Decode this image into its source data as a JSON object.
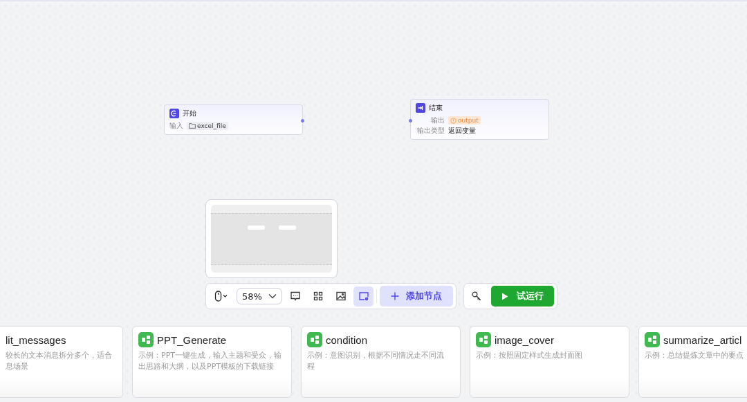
{
  "nodes": [
    {
      "kind": "start",
      "title": "开始",
      "fields": [
        {
          "label": "输入",
          "value": "excel_file"
        }
      ]
    },
    {
      "kind": "end",
      "title": "结束",
      "fields": [
        {
          "label": "输出",
          "value": "output"
        },
        {
          "label": "输出类型",
          "value": "返回变量"
        }
      ]
    }
  ],
  "toolbar": {
    "zoom": "58%",
    "minimap_on": true,
    "add_node": "添加节点",
    "run": "试运行"
  },
  "cards": [
    {
      "title": "lit_messages",
      "desc": [
        "较长的文本消息拆分多个，适合",
        "息场景"
      ],
      "icon": false
    },
    {
      "title": "PPT_Generate",
      "desc": [
        "示例：PPT一键生成，输入主题和受众，输出思路和大纲，以及PPT模板的下载链接"
      ],
      "icon": true
    },
    {
      "title": "condition",
      "desc": [
        "示例：意图识别，根据不同情况走不同流程"
      ],
      "icon": true
    },
    {
      "title": "image_cover",
      "desc": [
        "示例：按照固定样式生成封面图"
      ],
      "icon": true
    },
    {
      "title": "summarize_articl",
      "desc": [
        "示例：总结提炼文章中的要点"
      ],
      "icon": true
    }
  ]
}
